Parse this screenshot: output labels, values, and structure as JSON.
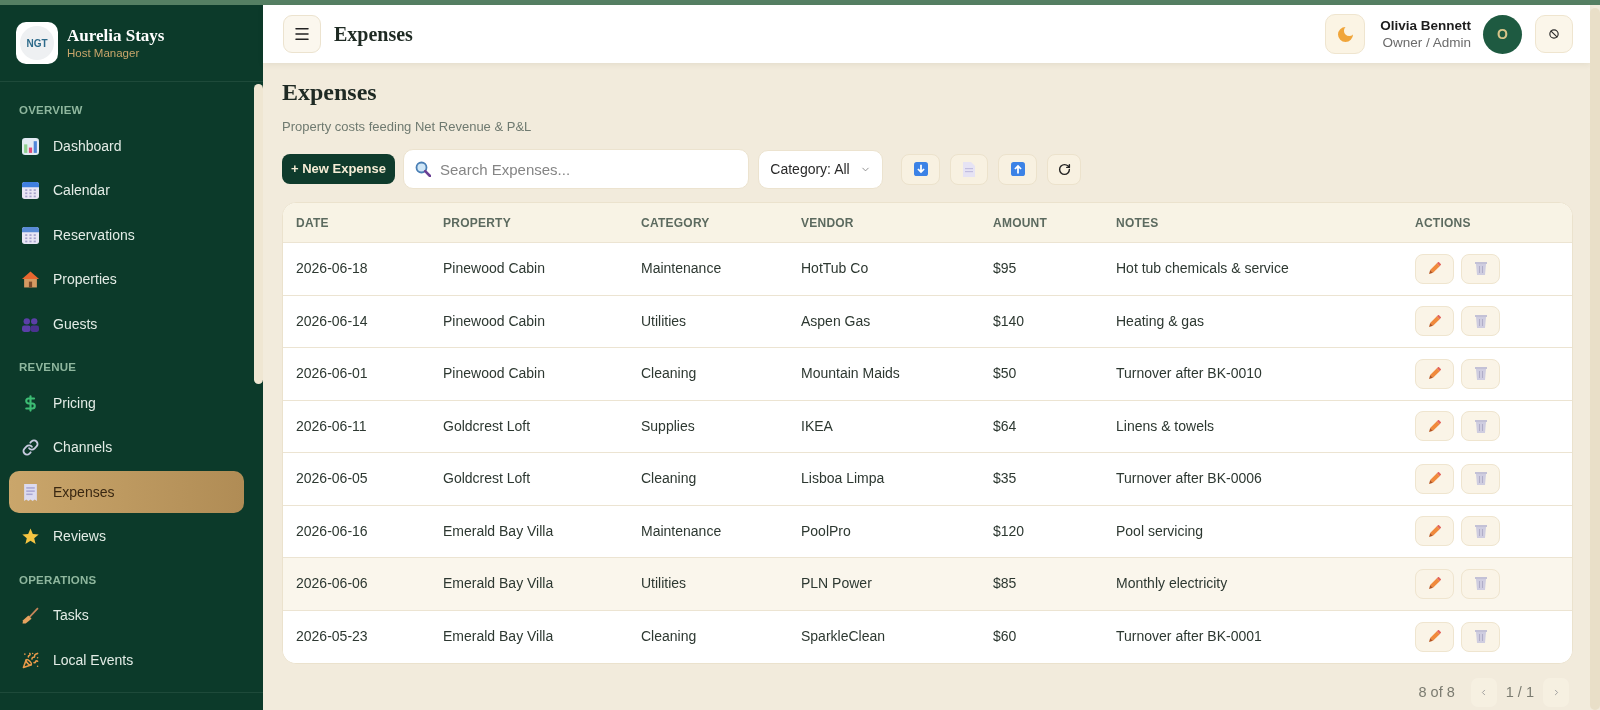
{
  "app": {
    "logo_text": "NGT",
    "name": "Aurelia Stays",
    "subtitle": "Host Manager"
  },
  "sidebar": {
    "sections": [
      {
        "title": "OVERVIEW",
        "items": [
          {
            "label": "Dashboard",
            "selected": false
          },
          {
            "label": "Calendar",
            "selected": false
          },
          {
            "label": "Reservations",
            "selected": false
          },
          {
            "label": "Properties",
            "selected": false
          },
          {
            "label": "Guests",
            "selected": false
          }
        ]
      },
      {
        "title": "REVENUE",
        "items": [
          {
            "label": "Pricing",
            "selected": false
          },
          {
            "label": "Channels",
            "selected": false
          },
          {
            "label": "Expenses",
            "selected": true
          },
          {
            "label": "Reviews",
            "selected": false
          }
        ]
      },
      {
        "title": "OPERATIONS",
        "items": [
          {
            "label": "Tasks",
            "selected": false
          },
          {
            "label": "Local Events",
            "selected": false
          }
        ]
      }
    ]
  },
  "header": {
    "title": "Expenses",
    "user": {
      "name": "Olivia Bennett",
      "role": "Owner / Admin",
      "initial": "O"
    }
  },
  "page": {
    "title": "Expenses",
    "subtitle": "Property costs feeding Net Revenue & P&L"
  },
  "toolbar": {
    "new_button": "+ New Expense",
    "search": {
      "placeholder": "Search Expenses..."
    },
    "category_filter": "Category: All"
  },
  "table": {
    "columns": [
      "DATE",
      "PROPERTY",
      "CATEGORY",
      "VENDOR",
      "AMOUNT",
      "NOTES",
      "ACTIONS"
    ],
    "rows": [
      {
        "date": "2026-06-18",
        "property": "Pinewood Cabin",
        "category": "Maintenance",
        "vendor": "HotTub Co",
        "amount": "$95",
        "notes": "Hot tub chemicals & service",
        "highlighted": false
      },
      {
        "date": "2026-06-14",
        "property": "Pinewood Cabin",
        "category": "Utilities",
        "vendor": "Aspen Gas",
        "amount": "$140",
        "notes": "Heating & gas",
        "highlighted": false
      },
      {
        "date": "2026-06-01",
        "property": "Pinewood Cabin",
        "category": "Cleaning",
        "vendor": "Mountain Maids",
        "amount": "$50",
        "notes": "Turnover after BK-0010",
        "highlighted": false
      },
      {
        "date": "2026-06-11",
        "property": "Goldcrest Loft",
        "category": "Supplies",
        "vendor": "IKEA",
        "amount": "$64",
        "notes": "Linens & towels",
        "highlighted": false
      },
      {
        "date": "2026-06-05",
        "property": "Goldcrest Loft",
        "category": "Cleaning",
        "vendor": "Lisboa Limpa",
        "amount": "$35",
        "notes": "Turnover after BK-0006",
        "highlighted": false
      },
      {
        "date": "2026-06-16",
        "property": "Emerald Bay Villa",
        "category": "Maintenance",
        "vendor": "PoolPro",
        "amount": "$120",
        "notes": "Pool servicing",
        "highlighted": false
      },
      {
        "date": "2026-06-06",
        "property": "Emerald Bay Villa",
        "category": "Utilities",
        "vendor": "PLN Power",
        "amount": "$85",
        "notes": "Monthly electricity",
        "highlighted": true
      },
      {
        "date": "2026-05-23",
        "property": "Emerald Bay Villa",
        "category": "Cleaning",
        "vendor": "SparkleClean",
        "amount": "$60",
        "notes": "Turnover after BK-0001",
        "highlighted": false
      }
    ]
  },
  "pagination": {
    "count": "8 of 8",
    "page": "1 / 1"
  }
}
